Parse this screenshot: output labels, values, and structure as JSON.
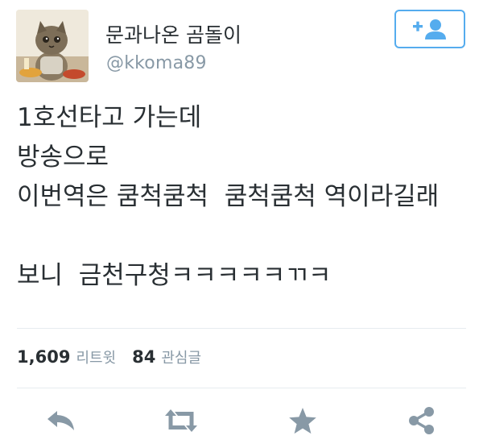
{
  "user": {
    "display_name": "문과나온 곰돌이",
    "handle": "@kkoma89"
  },
  "follow_button": {
    "icon": "follow-plus-person-icon",
    "color": "#55acee"
  },
  "tweet": {
    "lines": [
      "1호선타고 가는데",
      "방송으로",
      "이번역은 쿰척쿰척  쿰척쿰척 역이라길래",
      "",
      "보니  금천구청ㅋㅋㅋㅋㅋㄲㅋ"
    ]
  },
  "stats": {
    "retweets_count": "1,609",
    "retweets_label": "리트윗",
    "favorites_count": "84",
    "favorites_label": "관심글"
  },
  "actions": [
    {
      "name": "reply",
      "icon": "reply-icon"
    },
    {
      "name": "retweet",
      "icon": "retweet-icon"
    },
    {
      "name": "favorite",
      "icon": "star-icon"
    },
    {
      "name": "share",
      "icon": "share-icon"
    }
  ],
  "colors": {
    "text": "#292f33",
    "secondary": "#8899a6",
    "accent": "#55acee",
    "icon": "#8899a6",
    "divider": "#e6ecf0"
  }
}
